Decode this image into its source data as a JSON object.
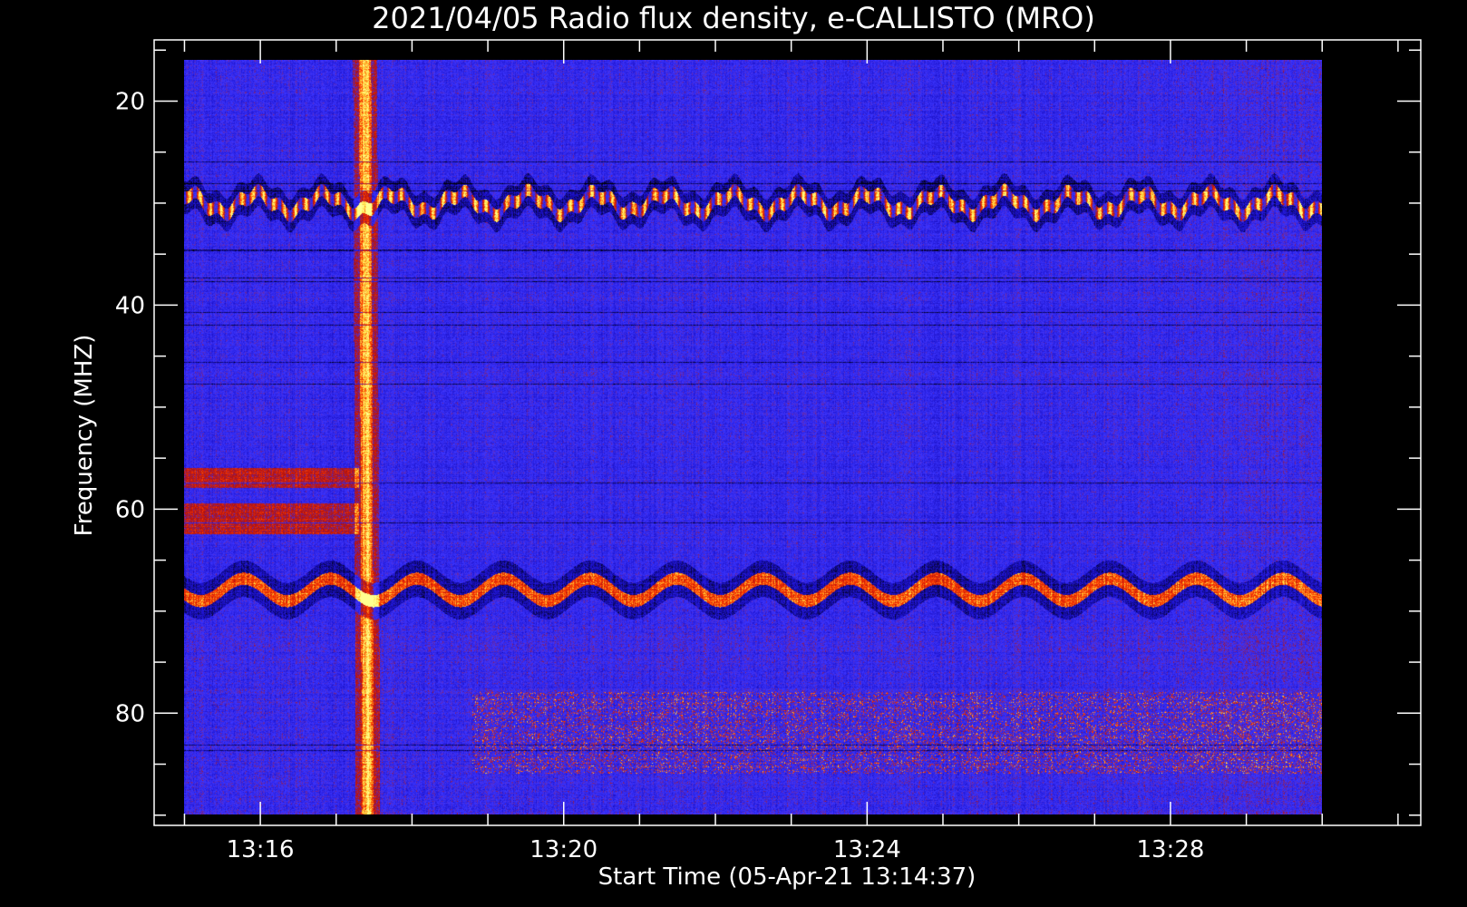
{
  "chart_data": {
    "type": "heatmap",
    "title": "2021/04/05  Radio flux density, e-CALLISTO (MRO)",
    "xlabel": "Start Time (05-Apr-21 13:14:37)",
    "ylabel": "Frequency (MHZ)",
    "x_ticks": [
      "13:16",
      "13:20",
      "13:24",
      "13:28"
    ],
    "x_tick_values_min": [
      796,
      800,
      804,
      808
    ],
    "y_ticks": [
      "20",
      "40",
      "60",
      "80"
    ],
    "y_tick_values": [
      20,
      40,
      60,
      80
    ],
    "x_range_min": [
      794.6,
      811.3
    ],
    "y_range": [
      14,
      91
    ],
    "data_range_x_min": [
      795.0,
      810.0
    ],
    "data_range_y": [
      16,
      90
    ],
    "y_inverted": true,
    "colormap": [
      "#000000",
      "#1a0fc6",
      "#3c35ff",
      "#b01010",
      "#ff3a00",
      "#ffd83a",
      "#ffff90"
    ],
    "features": [
      {
        "kind": "vertical_burst",
        "time_min": 797.4,
        "freq_range": [
          16,
          90
        ],
        "note": "bright broadband burst"
      },
      {
        "kind": "horizontal_band",
        "freq": 30,
        "note": "wavy interference band"
      },
      {
        "kind": "horizontal_band",
        "freq": 68,
        "note": "wavy interference band"
      }
    ]
  }
}
